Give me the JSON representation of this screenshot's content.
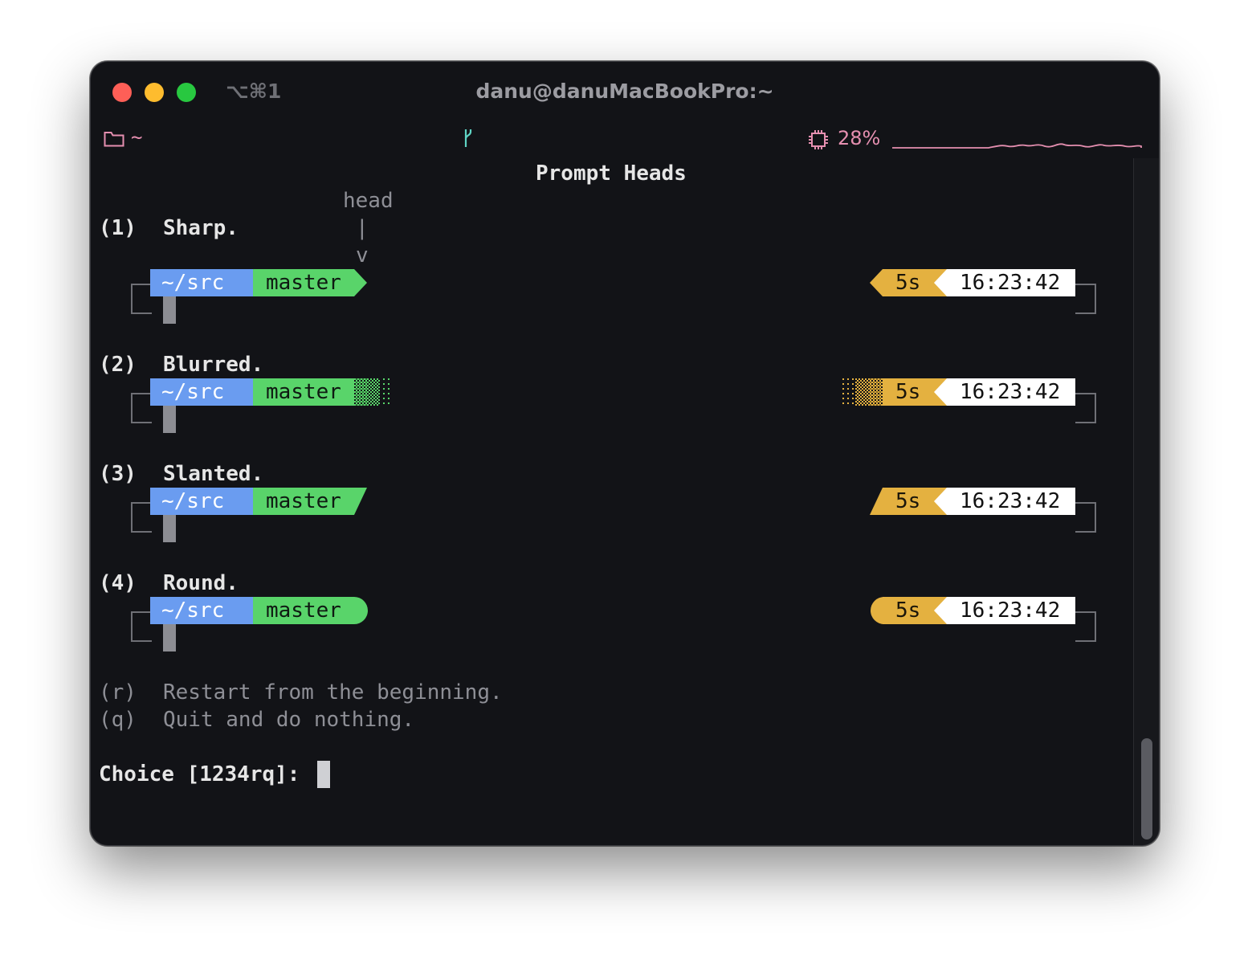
{
  "window": {
    "shortcut": "⌥⌘1",
    "title": "danu@danuMacBookPro:~"
  },
  "statusbar": {
    "cwd": "~",
    "cpu_percent": "28%",
    "accent_color": "#e58fb0"
  },
  "screen": {
    "heading": "Prompt Heads",
    "head_annotation": [
      "head",
      "|",
      "v"
    ],
    "options": [
      {
        "key": "(1)",
        "label": "Sharp."
      },
      {
        "key": "(2)",
        "label": "Blurred."
      },
      {
        "key": "(3)",
        "label": "Slanted."
      },
      {
        "key": "(4)",
        "label": "Round."
      }
    ],
    "prompt_preview": {
      "dir": "~/src",
      "branch": "master",
      "duration": "5s",
      "time": "16:23:42"
    },
    "extra_options": [
      {
        "key": "(r)",
        "label": "Restart from the beginning."
      },
      {
        "key": "(q)",
        "label": "Quit and do nothing."
      }
    ],
    "choice_prompt": "Choice [1234rq]: "
  },
  "colors": {
    "dir_segment": "#6a9cf0",
    "branch_segment": "#59d46a",
    "duration_segment": "#e4b140",
    "time_segment": "#ffffff"
  }
}
